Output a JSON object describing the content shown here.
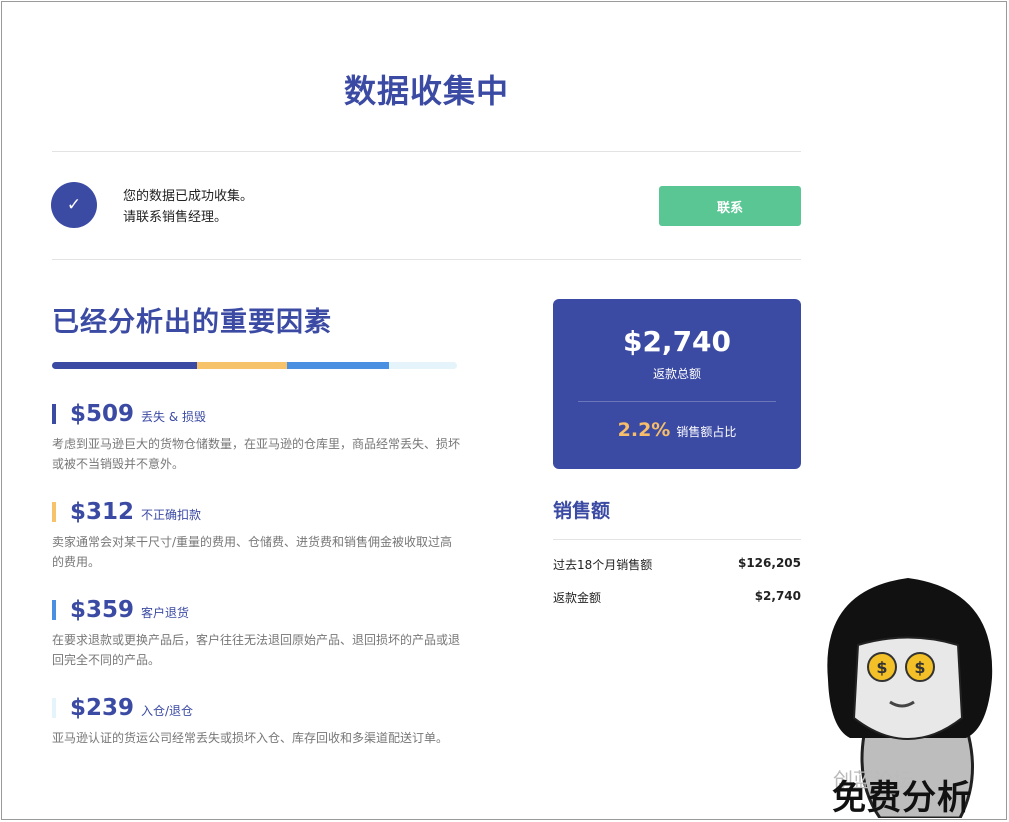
{
  "header": {
    "title": "数据收集中"
  },
  "status": {
    "line1": "您的数据已成功收集。",
    "line2": "请联系销售经理。",
    "contact_button": "联系",
    "check_icon": "✓"
  },
  "factors": {
    "title": "已经分析出的重要因素",
    "bar_colors": [
      "#3b4aa3",
      "#f6c26a",
      "#4a90e2",
      "#e5f3fa"
    ],
    "bar_shares": [
      0.186,
      0.114,
      0.131,
      0.087
    ],
    "items": [
      {
        "amount": "$509",
        "label": "丢失 & 损毁",
        "desc": "考虑到亚马逊巨大的货物仓储数量，在亚马逊的仓库里，商品经常丢失、损坏或被不当销毁并不意外。",
        "color": "#3b4aa3"
      },
      {
        "amount": "$312",
        "label": "不正确扣款",
        "desc": "卖家通常会对某干尺寸/重量的费用、仓储费、进货费和销售佣金被收取过高的费用。",
        "color": "#f6c26a"
      },
      {
        "amount": "$359",
        "label": "客户退货",
        "desc": "在要求退款或更换产品后，客户往往无法退回原始产品、退回损坏的产品或退回完全不同的产品。",
        "color": "#4a90e2"
      },
      {
        "amount": "$239",
        "label": "入仓/退仓",
        "desc": "亚马逊认证的货运公司经常丢失或损坏入仓、库存回收和多渠道配送订单。",
        "color": "#e5f3fa"
      }
    ]
  },
  "refund_card": {
    "amount": "$2,740",
    "label": "返款总额",
    "ratio": "2.2%",
    "ratio_label": "销售额占比"
  },
  "sales": {
    "title": "销售额",
    "rows": [
      {
        "label": "过去18个月销售额",
        "value": "$126,205"
      },
      {
        "label": "返款金额",
        "value": "$2,740"
      }
    ]
  },
  "overlay": {
    "caption": "免费分析",
    "watermark": "创蓝论坛"
  }
}
